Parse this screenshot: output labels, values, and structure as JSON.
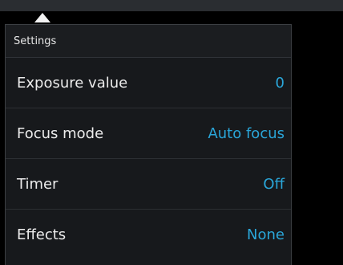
{
  "panel": {
    "title": "Settings",
    "items": [
      {
        "label": "Exposure value",
        "value": "0"
      },
      {
        "label": "Focus mode",
        "value": "Auto focus"
      },
      {
        "label": "Timer",
        "value": "Off"
      },
      {
        "label": "Effects",
        "value": "None"
      }
    ]
  },
  "colors": {
    "background": "#000000",
    "panel": "#17191c",
    "accent": "#2aa6d9",
    "text": "#ececec"
  },
  "icons": {
    "pointer": "triangle-up-icon"
  }
}
